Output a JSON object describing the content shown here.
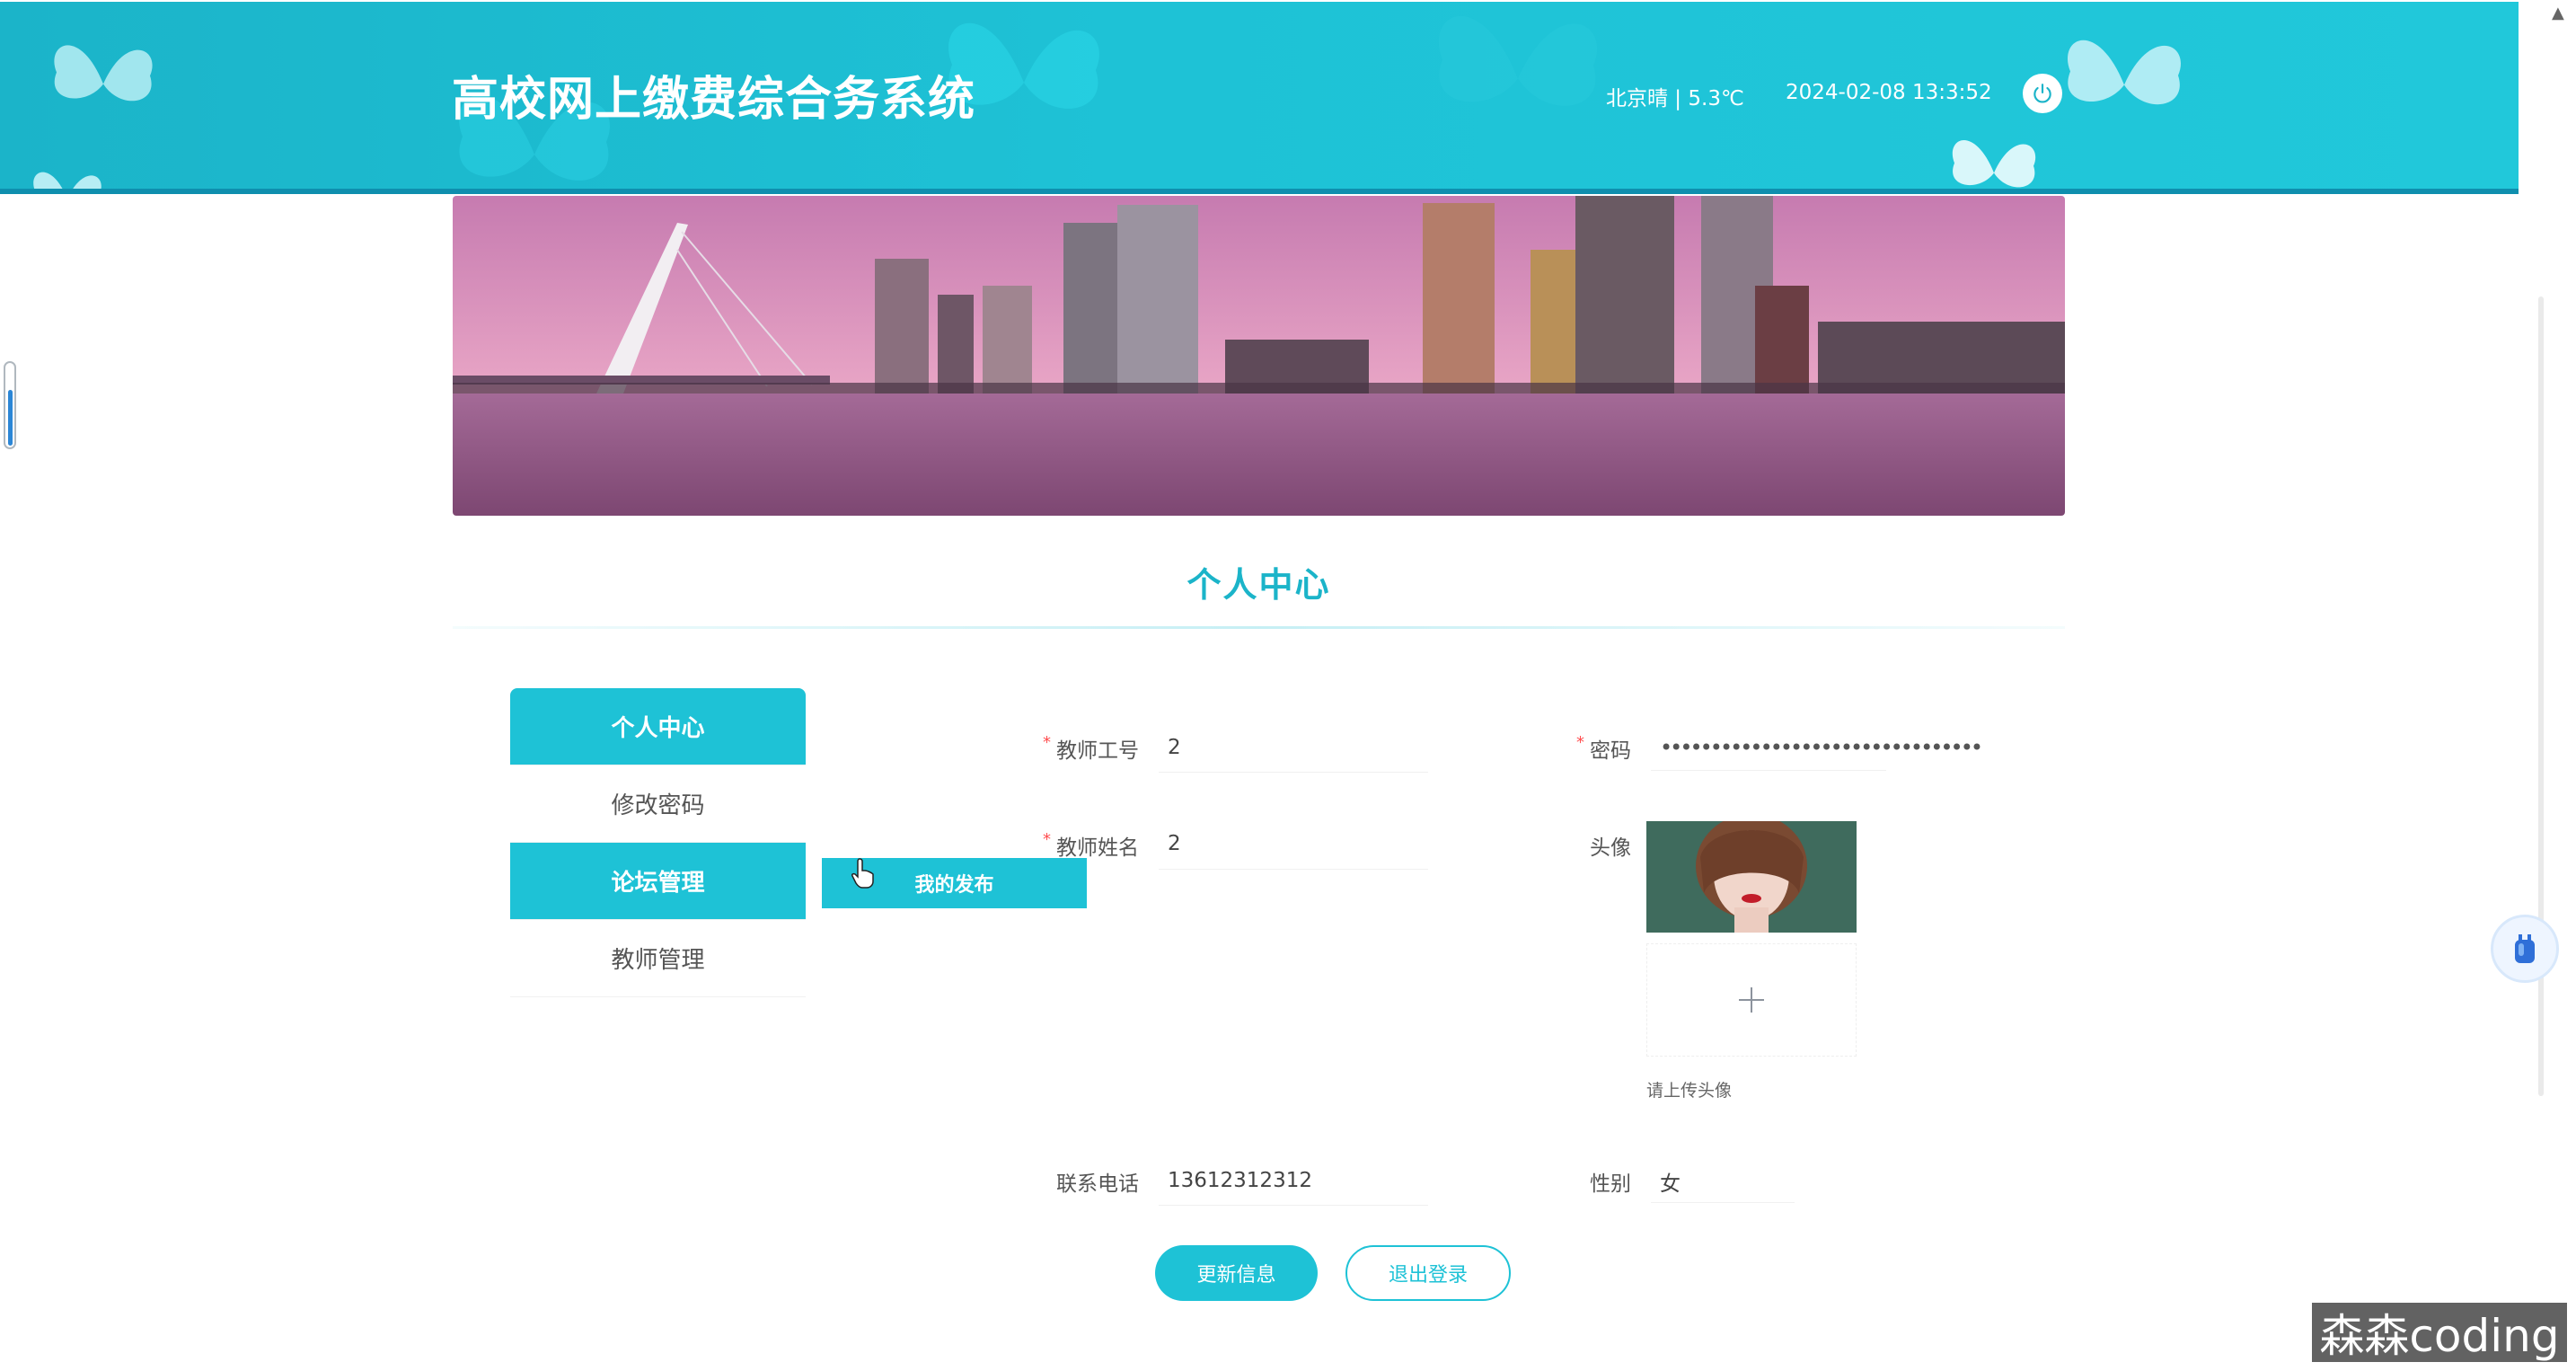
{
  "header": {
    "title": "高校网上缴费综合务系统",
    "weather": "北京晴 | 5.3℃",
    "datetime": "2024-02-08  13:3:52"
  },
  "page": {
    "title": "个人中心"
  },
  "menu": {
    "items": [
      {
        "label": "个人中心",
        "active": true
      },
      {
        "label": "修改密码",
        "active": false
      },
      {
        "label": "论坛管理",
        "active": true
      },
      {
        "label": "教师管理",
        "active": false
      }
    ],
    "submenu_label": "我的发布"
  },
  "form": {
    "teacher_id_label": "教师工号",
    "teacher_id_value": "2",
    "password_label": "密码",
    "password_value": "••••••••••••••••••••••••••••••••",
    "teacher_name_label": "教师姓名",
    "teacher_name_value": "2",
    "avatar_label": "头像",
    "upload_tip": "请上传头像",
    "phone_label": "联系电话",
    "phone_value": "13612312312",
    "gender_label": "性别",
    "gender_value": "女",
    "required_mark": "*"
  },
  "buttons": {
    "update": "更新信息",
    "logout": "退出登录"
  },
  "watermark": "森森coding",
  "colors": {
    "primary": "#1ec2d6",
    "header": "#1bb4c9",
    "required": "#ff4d4f"
  },
  "icons": [
    "butterfly-icon",
    "power-icon",
    "plus-icon",
    "cursor-hand-icon",
    "plugin-icon"
  ]
}
